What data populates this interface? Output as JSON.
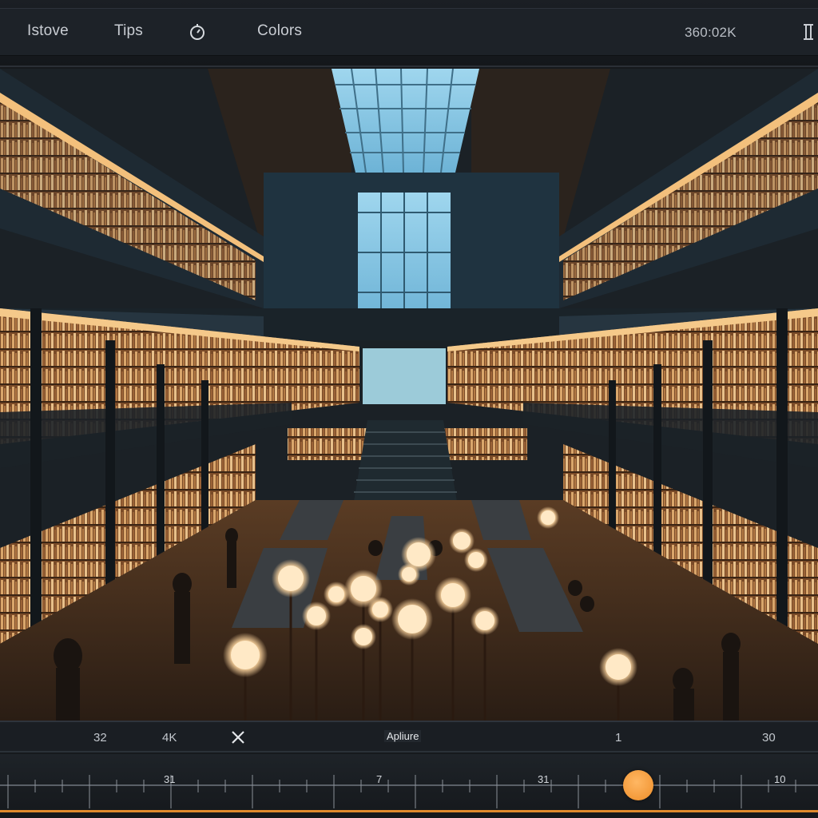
{
  "topbar": {
    "menu_1": "Istove",
    "menu_2": "Tips",
    "menu_3": "Colors",
    "resolution": "360:02K",
    "timer_icon": "stopwatch-icon",
    "side_icon": "panel-icon"
  },
  "viewer": {
    "scene": "library-atrium-image"
  },
  "infobar": {
    "value_left": "32",
    "value_quality": "4K",
    "close_icon": "close-icon",
    "mode_label": "Apliure",
    "value_mid": "1",
    "value_right": "30"
  },
  "ruler": {
    "labels": [
      "31",
      "7",
      "31",
      "10"
    ],
    "position": 0.78
  },
  "colors": {
    "accent": "#f39a3a",
    "background": "#16191d",
    "warm_light": "#ffd7a0"
  }
}
